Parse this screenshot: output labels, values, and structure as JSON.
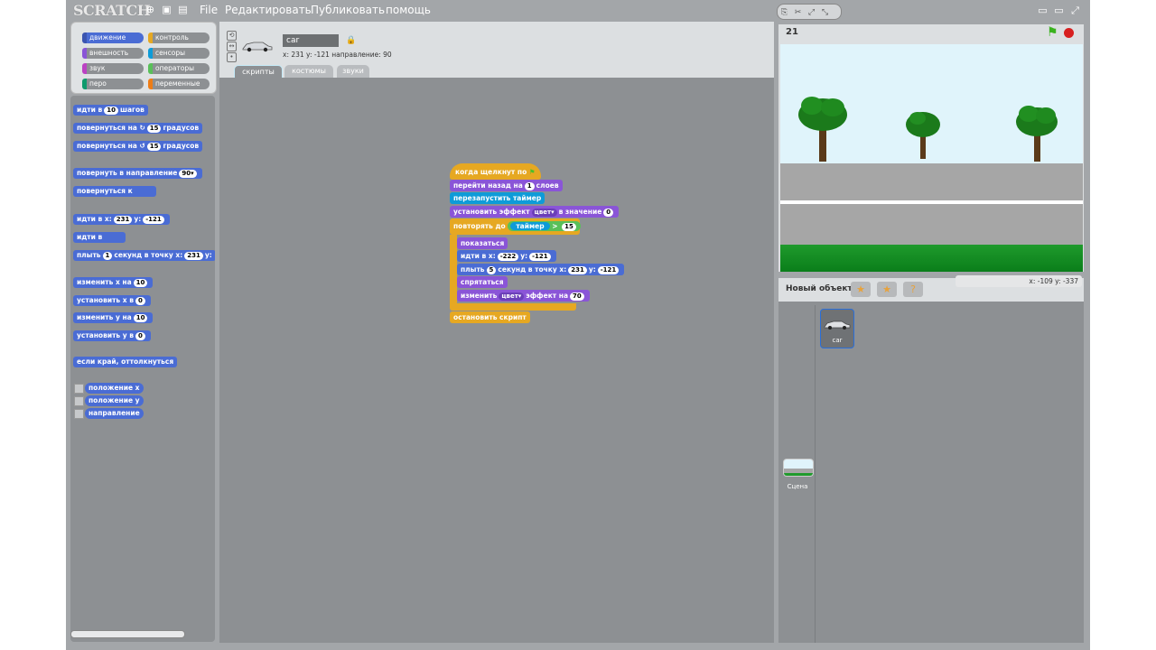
{
  "menubar": {
    "logo": "SCRATCH",
    "menu_file": "File",
    "menu_edit": "Редактировать",
    "menu_share": "Публиковать",
    "menu_help": "помощь"
  },
  "categories": {
    "motion": "движение",
    "control": "контроль",
    "looks": "внешность",
    "sensing": "сенсоры",
    "sound": "звук",
    "operators": "операторы",
    "pen": "перо",
    "variables": "переменные"
  },
  "palette": {
    "move": "идти в",
    "move_steps_val": "10",
    "move_steps_end": "шагов",
    "turn_right": "повернуться на",
    "turn_right_val": "15",
    "turn_right_end": "градусов",
    "turn_left": "повернуться на",
    "turn_left_val": "15",
    "turn_left_end": "градусов",
    "point_dir": "повернуть в направление",
    "point_dir_val": "90▾",
    "point_towards": "повернуться к",
    "goto_xy": "идти в х:",
    "goto_x_val": "231",
    "goto_y_label": "у:",
    "goto_y_val": "-121",
    "goto": "идти в",
    "glide": "плыть",
    "glide_val": "1",
    "glide_mid": "секунд в точку х:",
    "glide_x_val": "231",
    "glide_y_label": "у:",
    "change_x": "изменить х на",
    "change_x_val": "10",
    "set_x": "установить х в",
    "set_x_val": "0",
    "change_y": "изменить у на",
    "change_y_val": "10",
    "set_y": "установить у в",
    "set_y_val": "0",
    "bounce": "если край, оттолкнуться",
    "rep_x": "положение х",
    "rep_y": "положение у",
    "rep_dir": "направление"
  },
  "sprite": {
    "name": "car",
    "info": "x: 231  y: -121  направление: 90"
  },
  "tabs": {
    "scripts": "скрипты",
    "costumes": "костюмы",
    "sounds": "звуки"
  },
  "script": {
    "hat": "когда щелкнут по",
    "back": "перейти назад на",
    "back_val": "1",
    "back_end": "слоев",
    "reset_timer": "перезапустить таймер",
    "set_effect": "установить эффект",
    "set_effect_sel": "цвет▾",
    "set_effect_mid": "в значение",
    "set_effect_val": "0",
    "repeat": "повторять до",
    "timer": "таймер",
    "gt": ">",
    "gt_val": "15",
    "show": "показаться",
    "goto": "идти в х:",
    "goto_x": "-222",
    "goto_y_label": "у:",
    "goto_y": "-121",
    "glide": "плыть",
    "glide_sec": "5",
    "glide_mid": "секунд в точку х:",
    "glide_x": "231",
    "glide_y_label": "у:",
    "glide_y": "-121",
    "hide": "спрятаться",
    "change": "изменить",
    "change_sel": "цвет▾",
    "change_mid": "эффект на",
    "change_val": "70",
    "stop": "остановить скрипт"
  },
  "stage": {
    "counter": "21"
  },
  "sprites_panel": {
    "new_object": "Новый объект",
    "coords": "x: -109   y: -337",
    "car_label": "car",
    "stage_label": "Сцена"
  },
  "colors": {
    "motion": "#4a6cd4",
    "looks": "#8a55d7",
    "control": "#e6a822",
    "sensing": "#0e9bd8",
    "operators": "#59c059"
  }
}
